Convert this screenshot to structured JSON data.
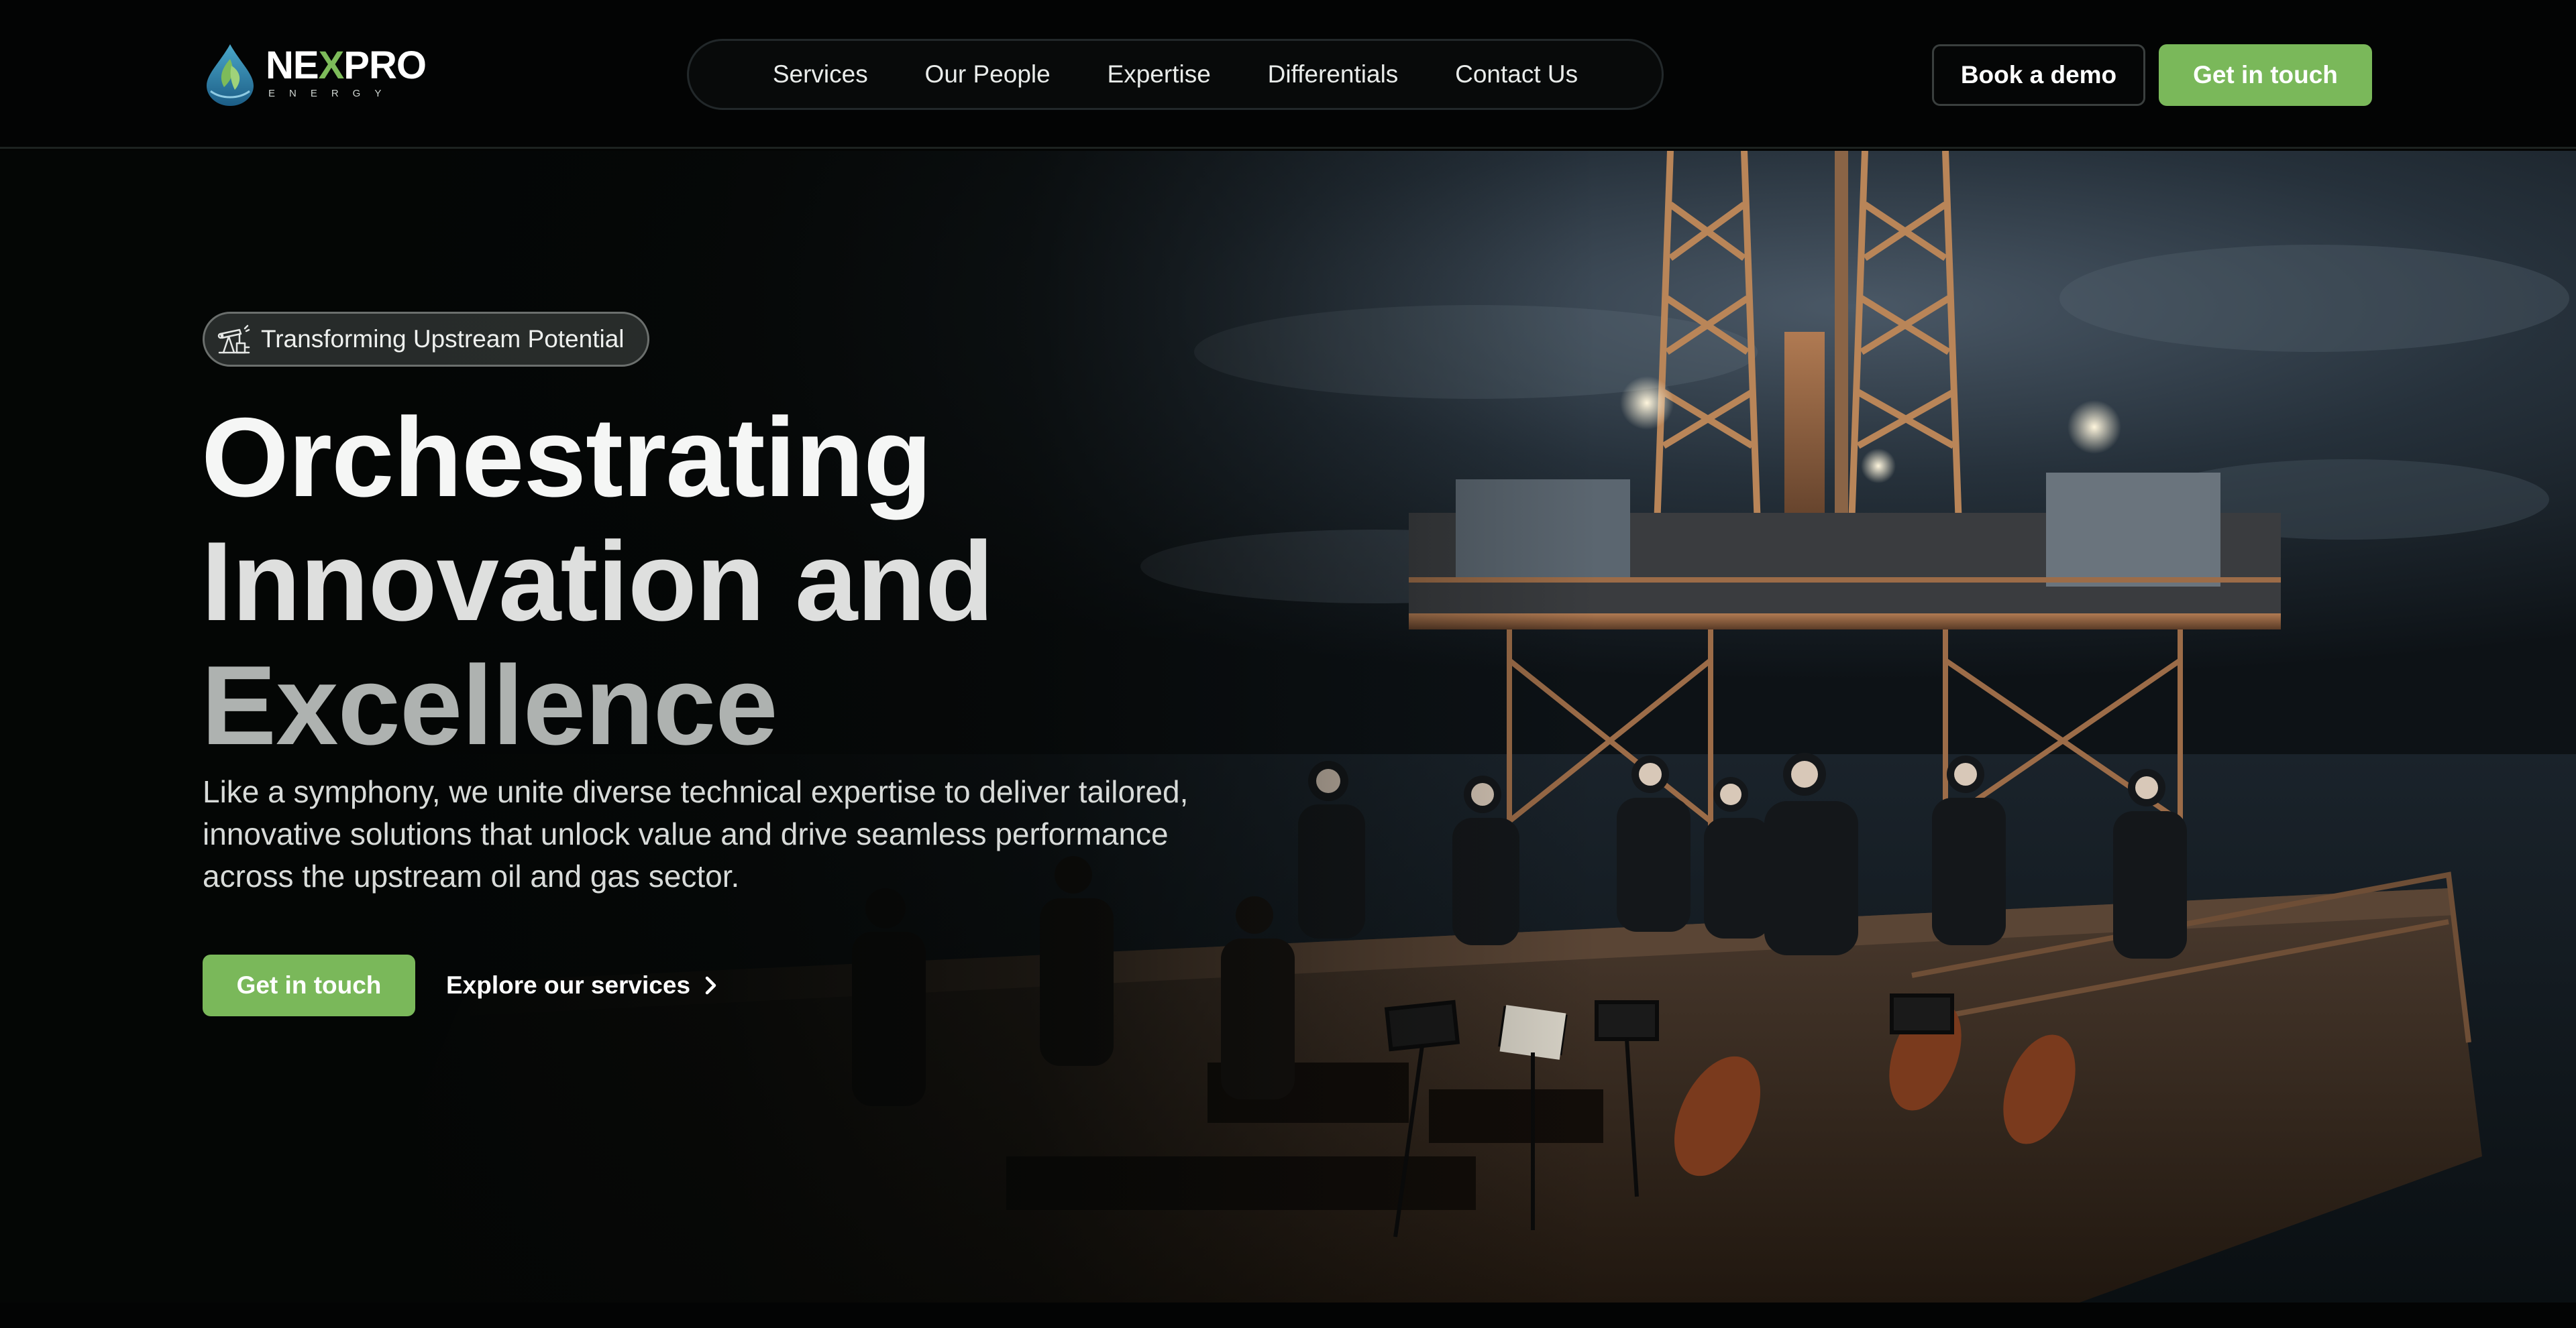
{
  "header": {
    "logo_word_pre": "NE",
    "logo_word_x": "X",
    "logo_word_post": "PRO",
    "logo_sub": "ENERGY",
    "nav": [
      {
        "label": "Services"
      },
      {
        "label": "Our People"
      },
      {
        "label": "Expertise"
      },
      {
        "label": "Differentials"
      },
      {
        "label": "Contact Us"
      }
    ],
    "book_demo": "Book a demo",
    "get_in_touch": "Get in touch"
  },
  "hero": {
    "badge_icon": "oil-pumpjack-icon",
    "badge": "Transforming Upstream Potential",
    "title_lines": [
      "Orchestrating",
      "Innovation and",
      "Excellence"
    ],
    "description": "Like a symphony, we unite diverse technical expertise to deliver tailored, innovative solutions that unlock value and drive seamless performance across the upstream oil and gas sector.",
    "cta_primary": "Get in touch",
    "cta_secondary": "Explore our services",
    "cta_secondary_icon": "chevron-right-icon"
  },
  "colors": {
    "accent": "#7ab85a",
    "background": "#040504",
    "nav_border": "#22282a"
  }
}
